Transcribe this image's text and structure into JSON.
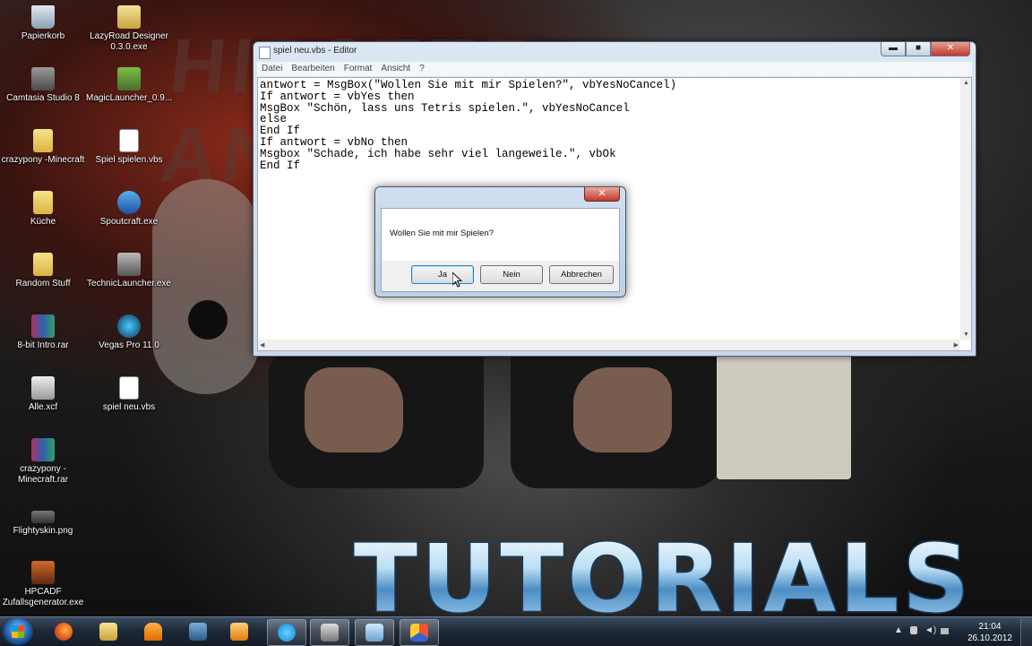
{
  "wallpaper": {
    "overlay_text": "TUTORIALS"
  },
  "desktop_icons": [
    {
      "label": "Papierkorb",
      "icon": "recycle-bin-icon"
    },
    {
      "label": "LazyRoad Designer 0.3.0.exe",
      "icon": "lazyroad-icon"
    },
    {
      "label": "Camtasia Studio 8",
      "icon": "camtasia-icon"
    },
    {
      "label": "MagicLauncher_0.9...",
      "icon": "magiclauncher-icon"
    },
    {
      "label": "crazypony -Minecraft",
      "icon": "folder-icon"
    },
    {
      "label": "Spiel spielen.vbs",
      "icon": "vbs-script-icon"
    },
    {
      "label": "Küche",
      "icon": "folder-icon"
    },
    {
      "label": "Spoutcraft.exe",
      "icon": "spoutcraft-icon"
    },
    {
      "label": "Random Stuff",
      "icon": "folder-icon"
    },
    {
      "label": "TechnicLauncher.exe",
      "icon": "technic-icon"
    },
    {
      "label": "8-bit Intro.rar",
      "icon": "rar-archive-icon"
    },
    {
      "label": "Vegas Pro 11.0",
      "icon": "vegas-icon"
    },
    {
      "label": "Alle.xcf",
      "icon": "xcf-file-icon"
    },
    {
      "label": "spiel neu.vbs",
      "icon": "vbs-script-icon"
    },
    {
      "label": "crazypony -Minecraft.rar",
      "icon": "rar-archive-icon"
    },
    {
      "label": "Flightyskin.png",
      "icon": "image-file-icon"
    },
    {
      "label": "HPCADF Zufallsgenerator.exe",
      "icon": "hpcadf-icon"
    }
  ],
  "editor": {
    "title": "spiel neu.vbs - Editor",
    "menu": [
      "Datei",
      "Bearbeiten",
      "Format",
      "Ansicht",
      "?"
    ],
    "code": "antwort = MsgBox(\"Wollen Sie mit mir Spielen?\", vbYesNoCancel)\nIf antwort = vbYes then\nMsgBox \"Schön, lass uns Tetris spielen.\", vbYesNoCancel\nelse\nEnd If\nIf antwort = vbNo then\nMsgbox \"Schade, ich habe sehr viel langeweile.\", vbOk\nEnd If",
    "window_buttons": {
      "minimize": "▬",
      "maximize": "■",
      "close": "✕"
    }
  },
  "msgbox": {
    "message": "Wollen Sie mit mir Spielen?",
    "close": "✕",
    "buttons": {
      "yes": "Ja",
      "no": "Nein",
      "cancel": "Abbrechen"
    }
  },
  "taskbar": {
    "pinned": [
      "start-button",
      "firefox-icon",
      "explorer-icon",
      "vlc-icon",
      "camtasia-icon",
      "media-icon",
      "skype-icon",
      "mail-icon",
      "notepad-icon",
      "multicolor-app-icon"
    ],
    "clock_time": "21:04",
    "clock_date": "26.10.2012",
    "tray_expand": "▲"
  }
}
